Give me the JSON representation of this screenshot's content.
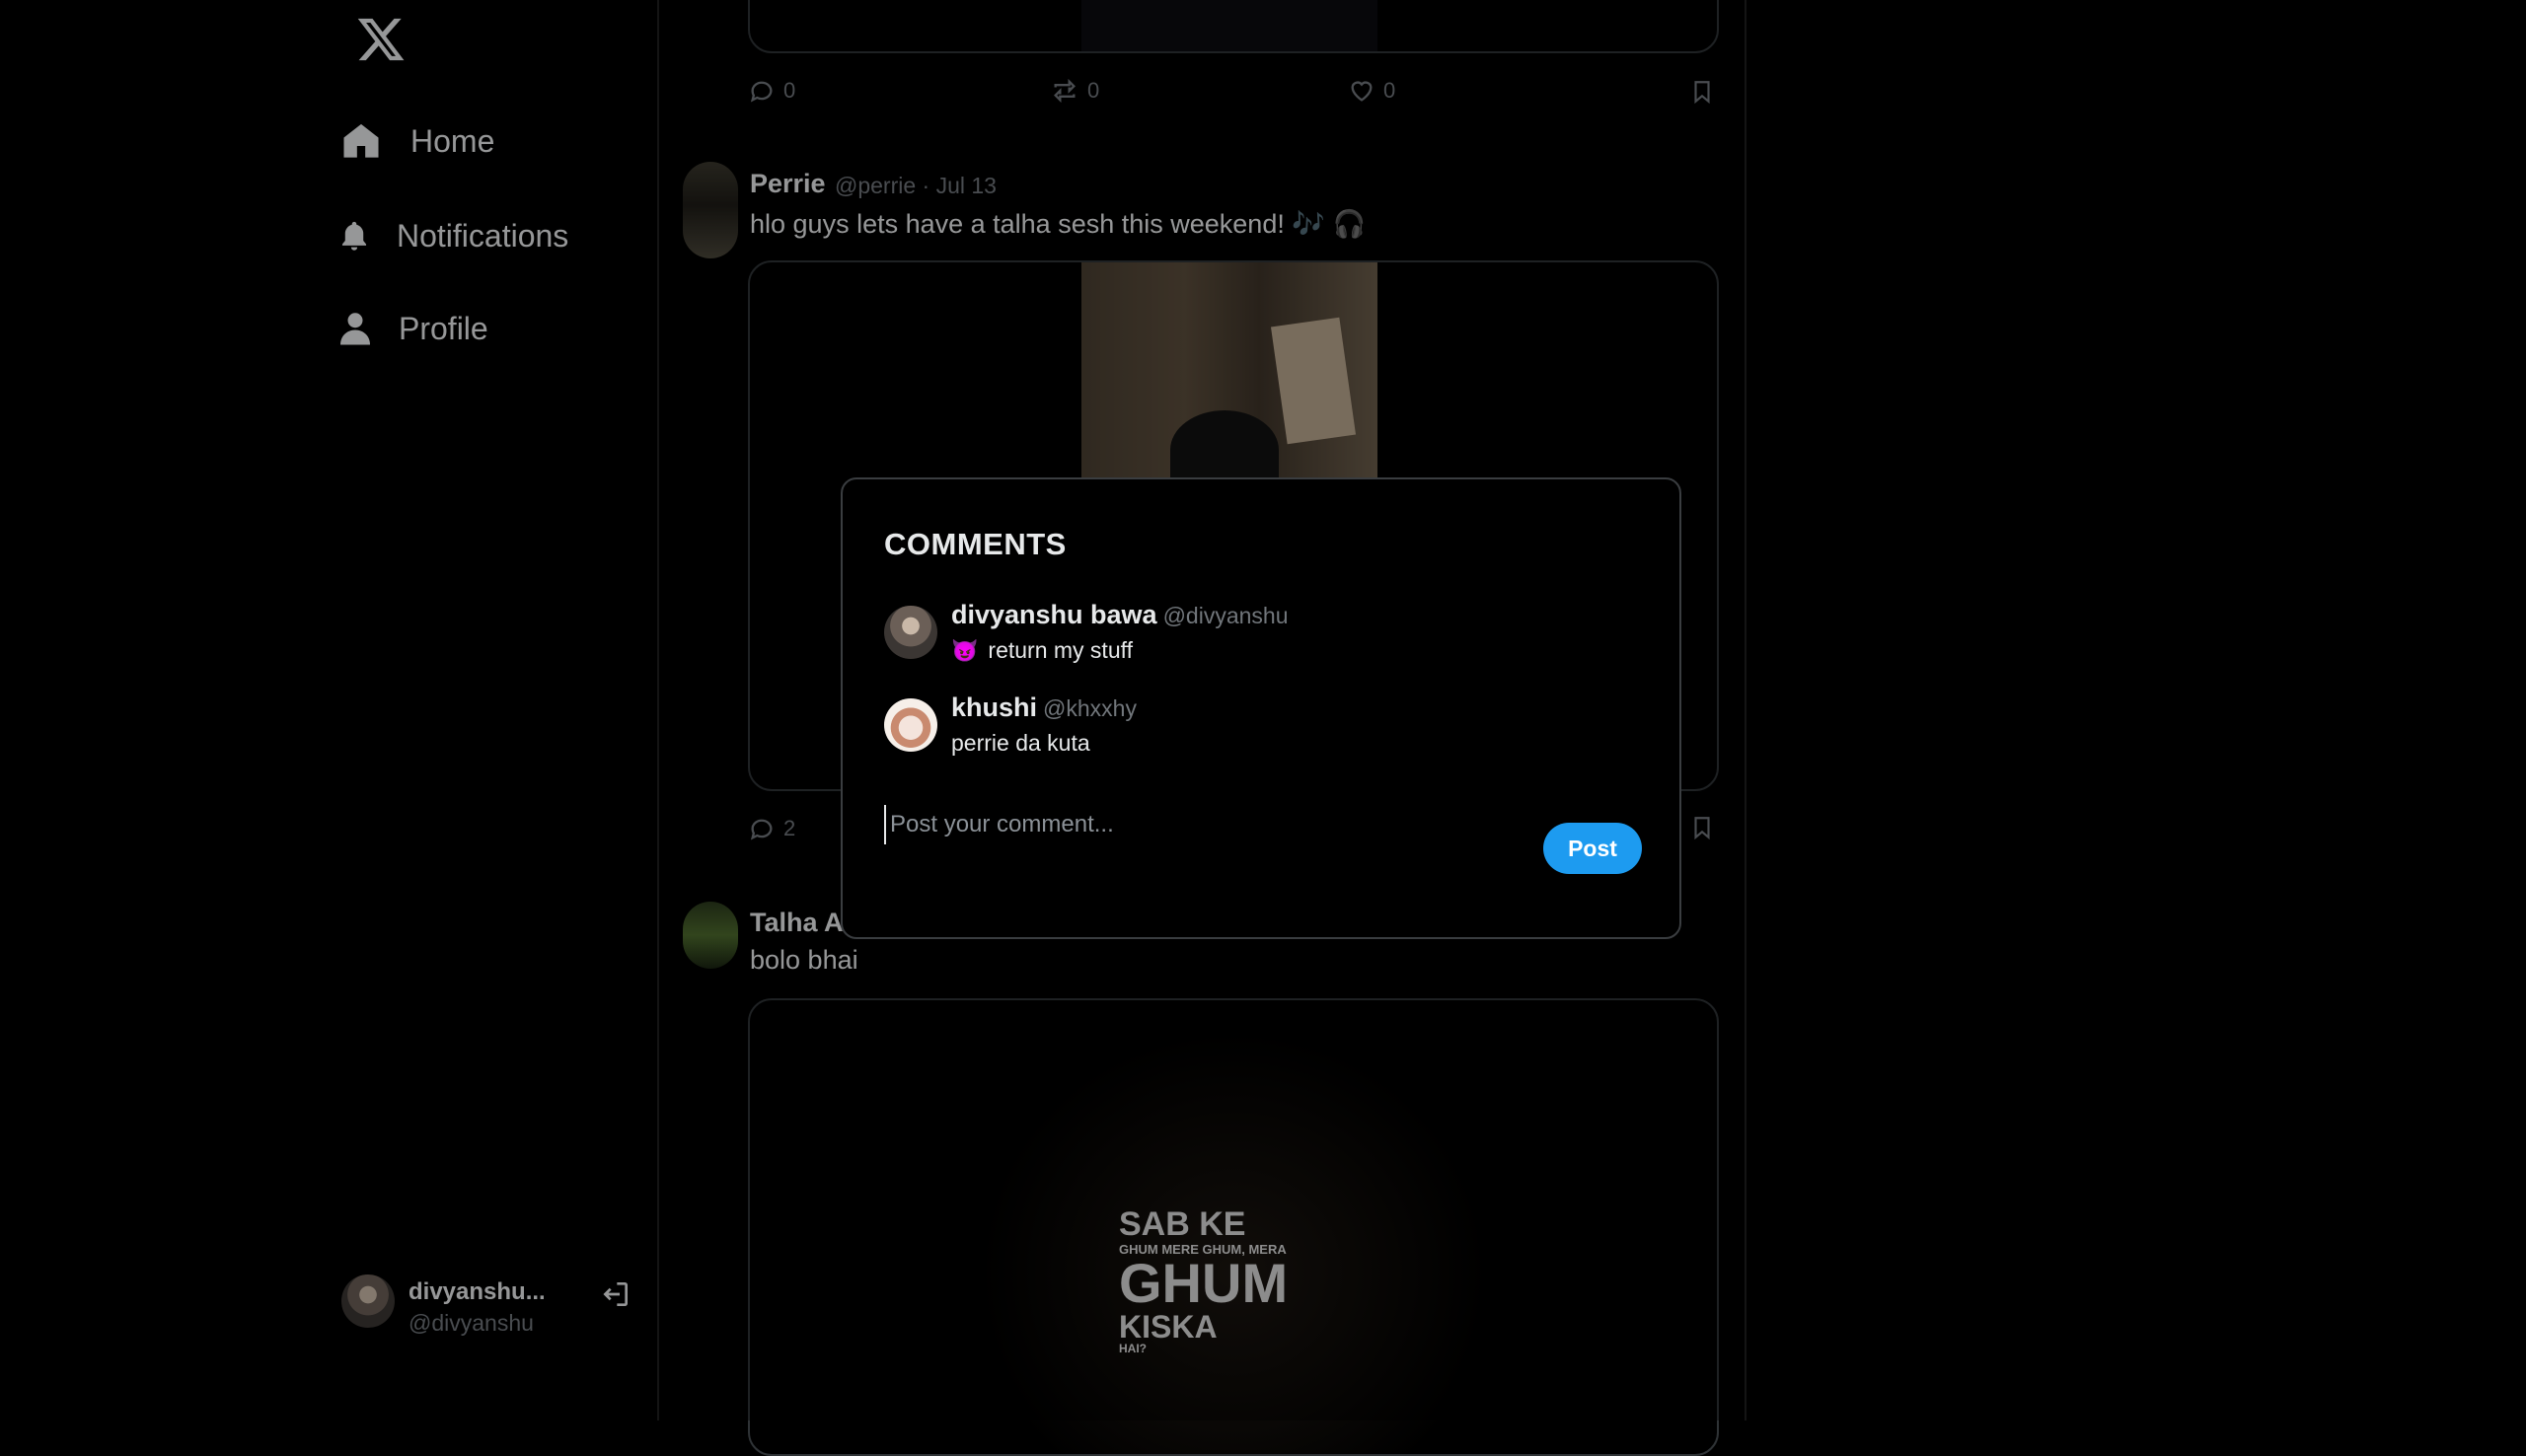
{
  "sidebar": {
    "logo": "x-logo-icon",
    "nav": [
      {
        "label": "Home",
        "icon": "home-icon"
      },
      {
        "label": "Notifications",
        "icon": "bell-icon"
      },
      {
        "label": "Profile",
        "icon": "person-icon"
      }
    ],
    "account": {
      "name": "divyanshu...",
      "handle": "@divyanshu",
      "logout_icon": "logout-icon"
    }
  },
  "feed": {
    "top_post_actions": {
      "comments": "0",
      "reposts": "0",
      "likes": "0"
    },
    "posts": [
      {
        "name": "Perrie",
        "meta": "@perrie · Jul 13",
        "text": "hlo guys lets have a talha sesh this weekend! 🎶 🎧",
        "comments": "2"
      },
      {
        "name": "Talha A",
        "text": "bolo bhai",
        "image_text": {
          "line1": "SAB KE",
          "line2": "GHUM MERE GHUM, MERA",
          "line3": "GHUM",
          "line4": "KISKA",
          "line5": "HAI?"
        }
      }
    ]
  },
  "modal": {
    "title": "COMMENTS",
    "comments": [
      {
        "name": "divyanshu bawa",
        "handle": "@divyanshu",
        "emoji": "😈",
        "text": "return my stuff"
      },
      {
        "name": "khushi",
        "handle": "@khxxhy",
        "text": "perrie da kuta"
      }
    ],
    "input_placeholder": "Post your comment...",
    "post_label": "Post"
  },
  "colors": {
    "accent": "#1d9bf0",
    "background": "#000000",
    "muted": "#71767b"
  }
}
